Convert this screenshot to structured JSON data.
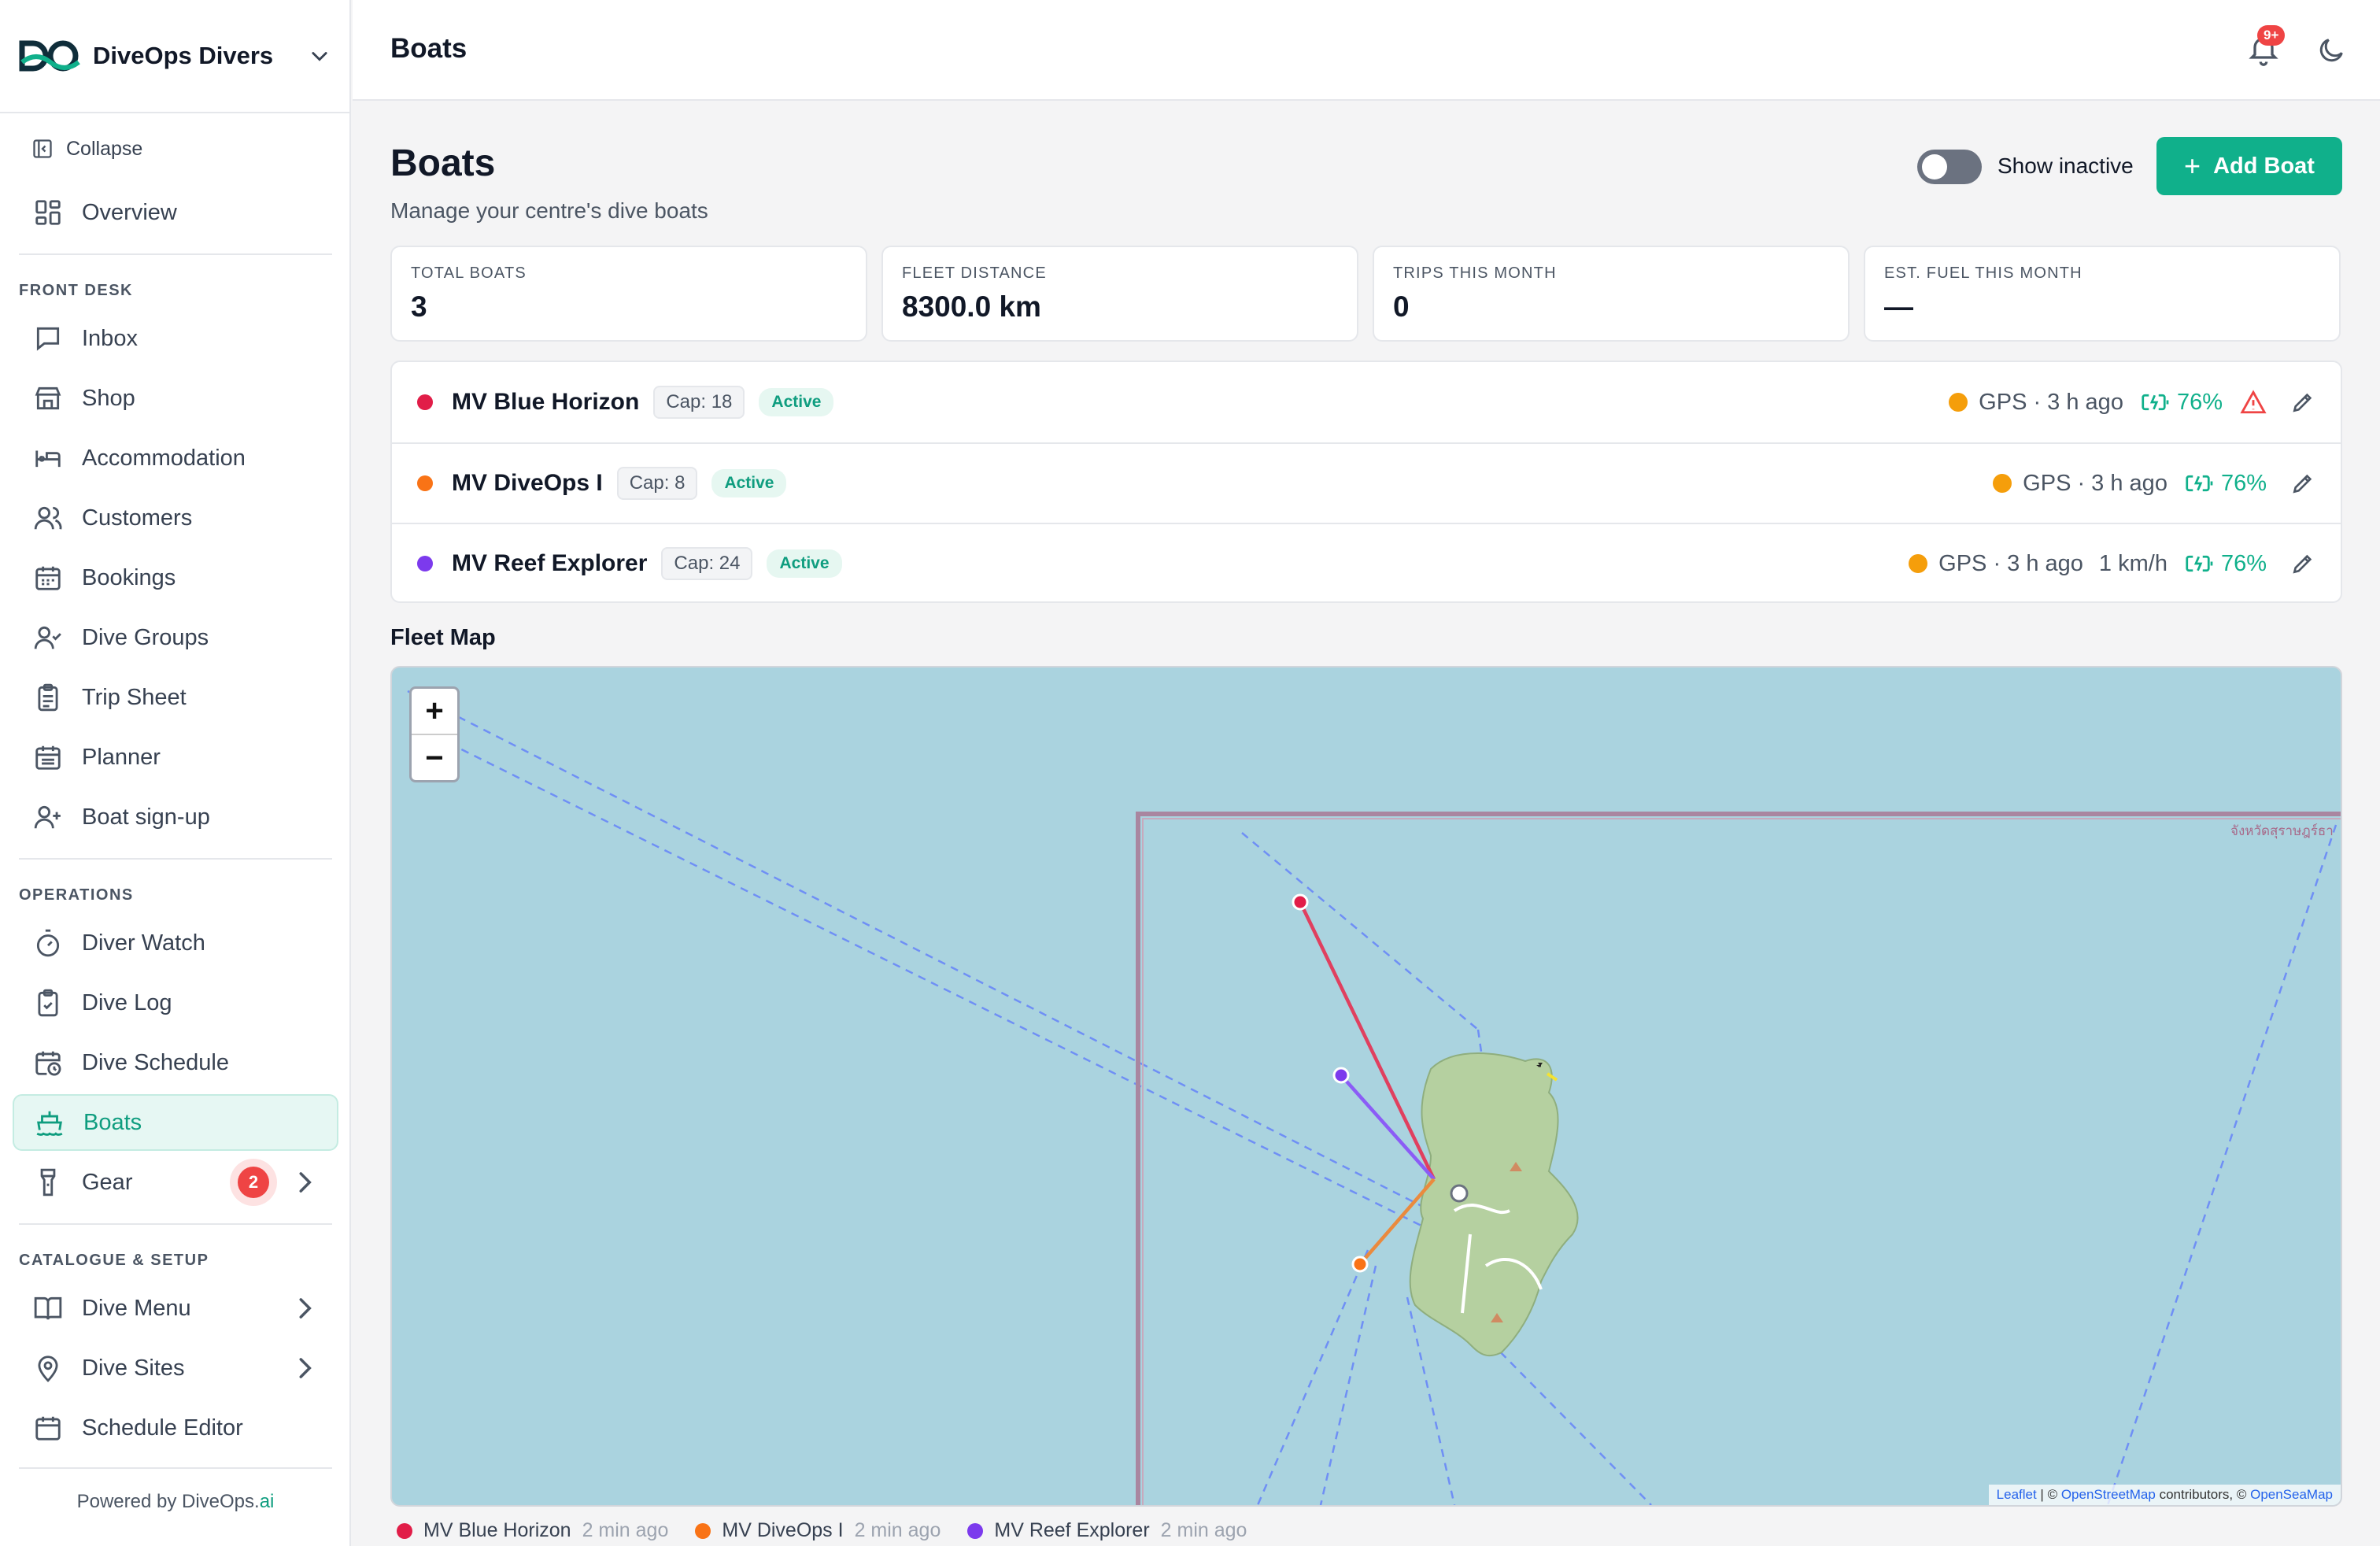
{
  "brand": {
    "name": "DiveOps Divers"
  },
  "sidebar": {
    "collapse": "Collapse",
    "overview": "Overview",
    "sections": {
      "front_desk": "FRONT DESK",
      "operations": "OPERATIONS",
      "catalogue": "CATALOGUE & SETUP"
    },
    "front_desk": [
      "Inbox",
      "Shop",
      "Accommodation",
      "Customers",
      "Bookings",
      "Dive Groups",
      "Trip Sheet",
      "Planner",
      "Boat sign-up"
    ],
    "operations": [
      "Diver Watch",
      "Dive Log",
      "Dive Schedule",
      "Boats",
      "Gear"
    ],
    "gear_badge": "2",
    "catalogue": [
      "Dive Menu",
      "Dive Sites",
      "Schedule Editor"
    ],
    "powered_prefix": "Powered by DiveOps.",
    "powered_suffix": "ai"
  },
  "topbar": {
    "title": "Boats",
    "notifications_badge": "9+"
  },
  "page": {
    "title": "Boats",
    "subtitle": "Manage your centre's dive boats",
    "show_inactive": "Show inactive",
    "add_boat": "Add Boat"
  },
  "stats": [
    {
      "label": "TOTAL BOATS",
      "value": "3"
    },
    {
      "label": "FLEET DISTANCE",
      "value": "8300.0 km"
    },
    {
      "label": "TRIPS THIS MONTH",
      "value": "0"
    },
    {
      "label": "EST. FUEL THIS MONTH",
      "value": "—"
    }
  ],
  "boats": [
    {
      "name": "MV Blue Horizon",
      "cap": "Cap: 18",
      "status": "Active",
      "color": "#e11d48",
      "gps": "GPS · 3 h ago",
      "speed": "",
      "battery": "76%",
      "warning": true
    },
    {
      "name": "MV DiveOps I",
      "cap": "Cap: 8",
      "status": "Active",
      "color": "#f97316",
      "gps": "GPS · 3 h ago",
      "speed": "",
      "battery": "76%",
      "warning": false
    },
    {
      "name": "MV Reef Explorer",
      "cap": "Cap: 24",
      "status": "Active",
      "color": "#7c3aed",
      "gps": "GPS · 3 h ago",
      "speed": "1 km/h",
      "battery": "76%",
      "warning": false
    }
  ],
  "map": {
    "title": "Fleet Map",
    "zoom_in": "+",
    "zoom_out": "−",
    "province_label": "จังหวัดสุราษฎร์ธา",
    "attribution": {
      "leaflet": "Leaflet",
      "sep1": " | © ",
      "osm": "OpenStreetMap",
      "contrib": " contributors, © ",
      "openseamap": "OpenSeaMap"
    }
  },
  "legend": [
    {
      "name": "MV Blue Horizon",
      "ago": "2 min ago",
      "color": "#e11d48"
    },
    {
      "name": "MV DiveOps I",
      "ago": "2 min ago",
      "color": "#f97316"
    },
    {
      "name": "MV Reef Explorer",
      "ago": "2 min ago",
      "color": "#7c3aed"
    }
  ],
  "colors": {
    "accent": "#10b08b",
    "gps": "#f59e0b",
    "warning": "#ef4444"
  }
}
